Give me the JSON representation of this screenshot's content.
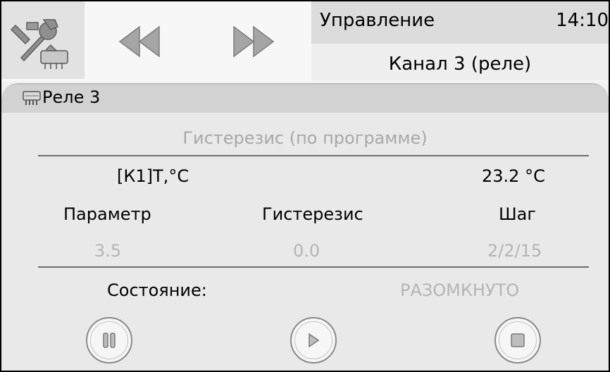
{
  "header": {
    "title": "Управление",
    "clock": "14:10",
    "subtitle": "Канал 3 (реле)",
    "tools_icon": "wrench-screwdriver-relay-icon",
    "prev_icon": "double-left-arrow-icon",
    "next_icon": "double-right-arrow-icon"
  },
  "section": {
    "icon": "relay-icon",
    "title": "Реле 3"
  },
  "mode": "Гистерезис (по программе)",
  "sensor": {
    "label": "[К1]T,°С",
    "value": "23.2 °С"
  },
  "params": {
    "col1_header": "Параметр",
    "col2_header": "Гистерезис",
    "col3_header": "Шаг",
    "col1_value": "3.5",
    "col2_value": "0.0",
    "col3_value": "2/2/15"
  },
  "state": {
    "label": "Состояние:",
    "value": "РАЗОМКНУТО"
  },
  "controls": {
    "pause_icon": "pause-icon",
    "play_icon": "play-icon",
    "stop_icon": "stop-icon"
  },
  "colors": {
    "frame_border": "#000000",
    "disabled_text": "#b5b5b5",
    "header_panel": "#dcdcdc"
  }
}
